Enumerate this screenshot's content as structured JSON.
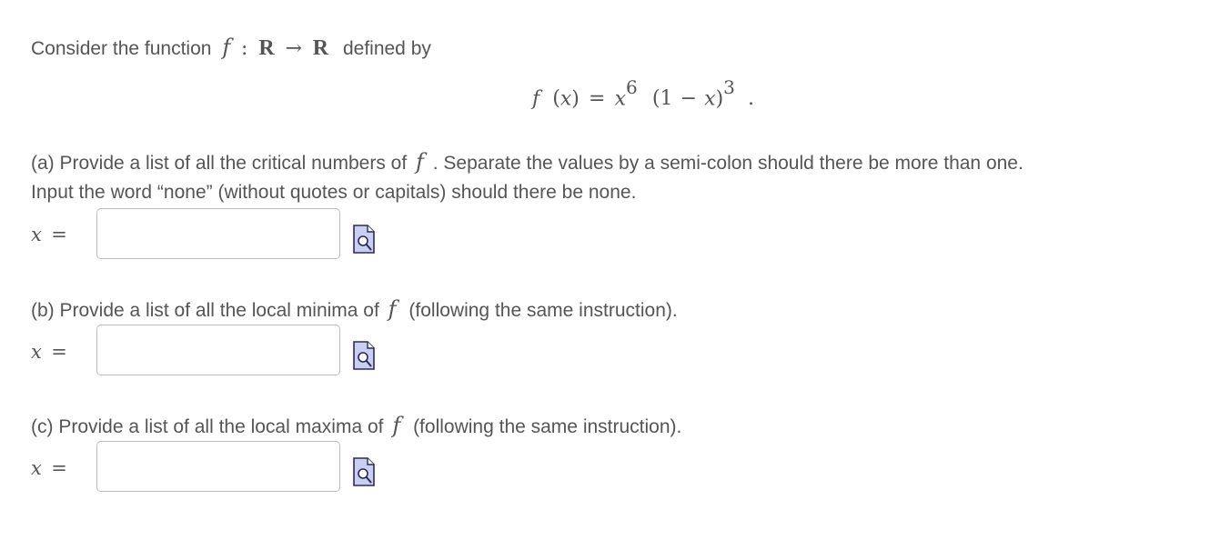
{
  "intro": {
    "prefix": "Consider the function",
    "f": "f",
    "colon": ":",
    "domain": "R",
    "arrow": "→",
    "codomain": "R",
    "suffix": "defined by"
  },
  "formula": {
    "f": "f",
    "lparen": "(",
    "x": "x",
    "rparen": ")",
    "equals": "=",
    "base1": "x",
    "exp1": "6",
    "open": "(1",
    "minus": "−",
    "base2": "x",
    "close": ")",
    "exp2": "3",
    "period": "."
  },
  "part_a": {
    "line1_prefix": "(a) Provide a list of all the critical numbers of",
    "f": "f",
    "line1_suffix": ". Separate the values by a semi-colon should there be more than one.",
    "line2": "Input the word “none” (without quotes or capitals) should there be none.",
    "var": "x",
    "eq": "=",
    "value": ""
  },
  "part_b": {
    "prefix": "(b) Provide a list of all the local minima of",
    "f": "f",
    "suffix": "(following the same instruction).",
    "var": "x",
    "eq": "=",
    "value": ""
  },
  "part_c": {
    "prefix": "(c) Provide a list of all the local maxima of",
    "f": "f",
    "suffix": "(following the same instruction).",
    "var": "x",
    "eq": "=",
    "value": ""
  },
  "icons": {
    "preview": "preview-icon"
  }
}
